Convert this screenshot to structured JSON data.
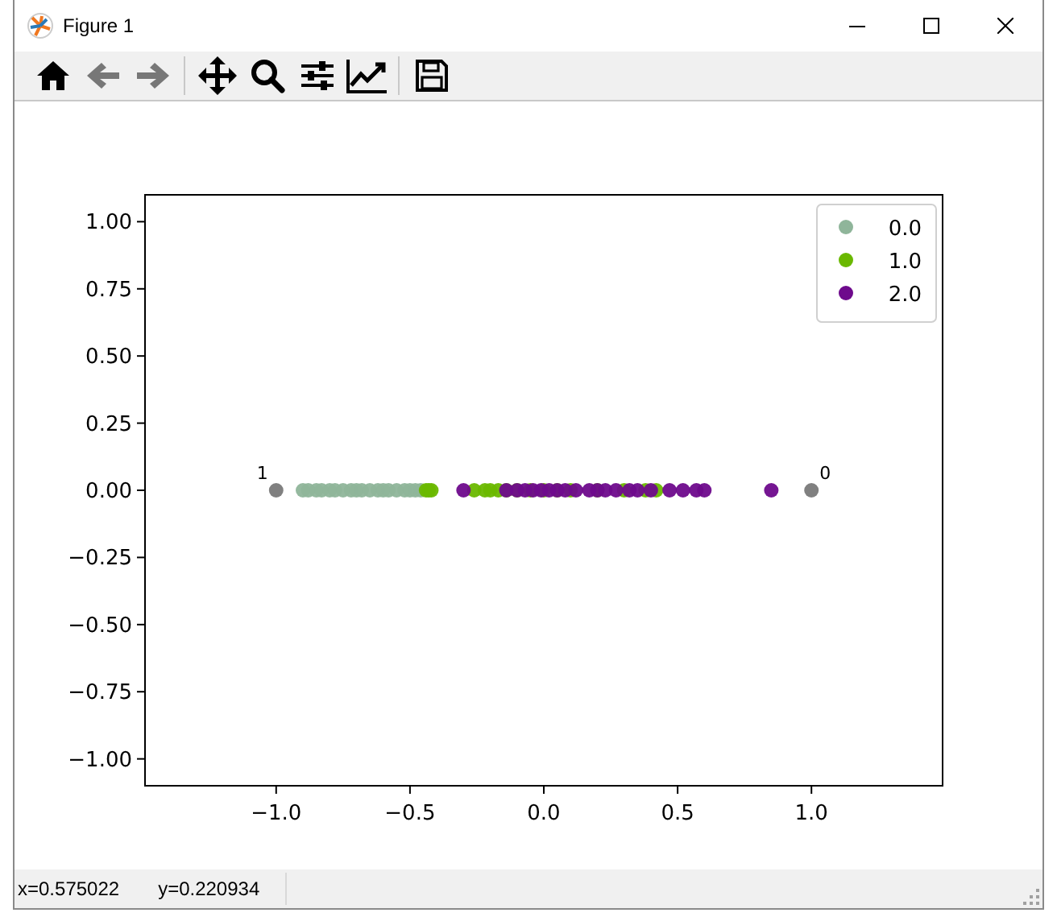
{
  "window": {
    "title": "Figure 1"
  },
  "toolbar": [
    {
      "kind": "home",
      "disabled": false
    },
    {
      "kind": "back",
      "disabled": true
    },
    {
      "kind": "forward",
      "disabled": true
    },
    {
      "kind": "separator"
    },
    {
      "kind": "pan",
      "disabled": false
    },
    {
      "kind": "zoom",
      "disabled": false
    },
    {
      "kind": "subplots",
      "disabled": false
    },
    {
      "kind": "customize",
      "disabled": false
    },
    {
      "kind": "separator"
    },
    {
      "kind": "save",
      "disabled": false
    }
  ],
  "figure": {
    "chart_data": {
      "type": "scatter",
      "legend": true,
      "xlim": [
        -1.49,
        1.49
      ],
      "ylim": [
        -1.1,
        1.1
      ],
      "xticks": [
        {
          "value": -1,
          "label": "−1.0"
        },
        {
          "value": -0.5,
          "label": "−0.5"
        },
        {
          "value": 0,
          "label": "0.0"
        },
        {
          "value": 0.5,
          "label": "0.5"
        },
        {
          "value": 1,
          "label": "1.0"
        }
      ],
      "yticks": [
        {
          "value": 1,
          "label": "1.00"
        },
        {
          "value": 0.75,
          "label": "0.75"
        },
        {
          "value": 0.5,
          "label": "0.50"
        },
        {
          "value": 0.25,
          "label": "0.25"
        },
        {
          "value": 0,
          "label": "0.00"
        },
        {
          "value": -0.25,
          "label": "−0.25"
        },
        {
          "value": -0.5,
          "label": "−0.50"
        },
        {
          "value": -0.75,
          "label": "−0.75"
        },
        {
          "value": -1,
          "label": "−1.00"
        }
      ],
      "series": [
        {
          "name": "0.0",
          "color": "#8fb59a",
          "x": [
            -0.9,
            -0.88,
            -0.85,
            -0.83,
            -0.8,
            -0.78,
            -0.75,
            -0.72,
            -0.7,
            -0.68,
            -0.65,
            -0.62,
            -0.6,
            -0.58,
            -0.55,
            -0.52,
            -0.5,
            -0.48,
            -0.46
          ],
          "values": [
            0,
            0,
            0,
            0,
            0,
            0,
            0,
            0,
            0,
            0,
            0,
            0,
            0,
            0,
            0,
            0,
            0,
            0,
            0
          ]
        },
        {
          "name": "1.0",
          "color": "#6ab800",
          "x": [
            -0.44,
            -0.43,
            -0.42,
            -0.26,
            -0.22,
            -0.2,
            -0.17,
            -0.14,
            -0.1,
            -0.05,
            0.0,
            0.05,
            0.1,
            0.2,
            0.3,
            0.38,
            0.42
          ],
          "values": [
            0,
            0,
            0,
            0,
            0,
            0,
            0,
            0,
            0,
            0,
            0,
            0,
            0,
            0,
            0,
            0,
            0
          ]
        },
        {
          "name": "2.0",
          "color": "#6e0a8c",
          "x": [
            -0.3,
            -0.14,
            -0.1,
            -0.07,
            -0.04,
            -0.01,
            0.02,
            0.05,
            0.08,
            0.12,
            0.17,
            0.2,
            0.23,
            0.27,
            0.32,
            0.35,
            0.4,
            0.47,
            0.52,
            0.57,
            0.6,
            0.85
          ],
          "values": [
            0,
            0,
            0,
            0,
            0,
            0,
            0,
            0,
            0,
            0,
            0,
            0,
            0,
            0,
            0,
            0,
            0,
            0,
            0,
            0,
            0,
            0
          ]
        }
      ],
      "annotations": [
        {
          "text": "1",
          "x": -1,
          "y": 0
        },
        {
          "text": "0",
          "x": 1,
          "y": 0
        }
      ]
    }
  },
  "status_bar": {
    "x_reading": "x=0.575022",
    "y_reading": "y=0.220934"
  }
}
